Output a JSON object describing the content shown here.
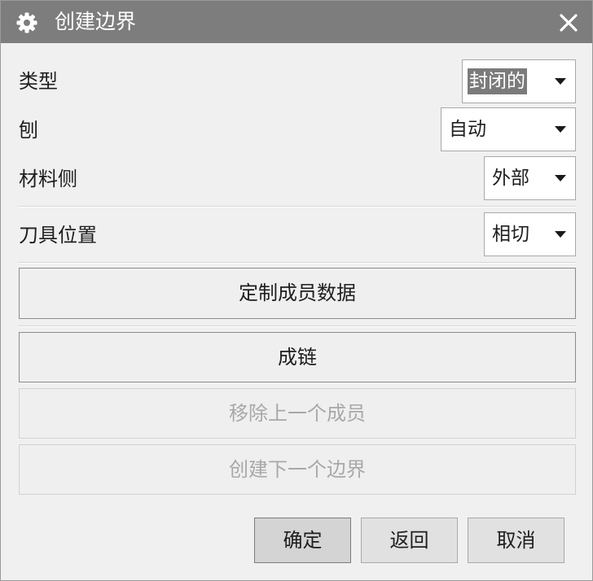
{
  "dialog": {
    "title": "创建边界",
    "title_icon": "gear-icon",
    "close_icon": "close-icon"
  },
  "fields": {
    "type": {
      "label": "类型",
      "value": "封闭的"
    },
    "plane": {
      "label": "刨",
      "value": "自动"
    },
    "material_side": {
      "label": "材料侧",
      "value": "外部"
    },
    "tool_position": {
      "label": "刀具位置",
      "value": "相切"
    }
  },
  "buttons": {
    "custom_member_data": "定制成员数据",
    "chain": "成链",
    "remove_previous_member": "移除上一个成员",
    "create_next_boundary": "创建下一个边界"
  },
  "footer": {
    "ok": "确定",
    "back": "返回",
    "cancel": "取消"
  },
  "colors": {
    "titlebar": "#7d7d7d",
    "dialog_bg": "#f0f0f0",
    "disabled_text": "#a8a8a8"
  }
}
